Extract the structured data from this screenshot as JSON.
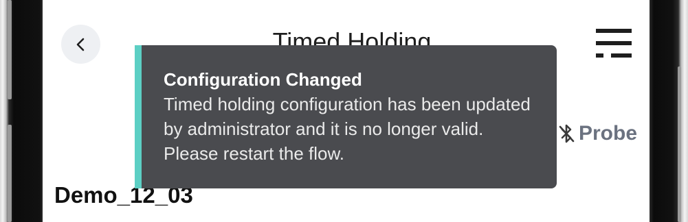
{
  "header": {
    "title": "Timed Holding",
    "back_icon": "chevron-left-icon",
    "menu_icon": "menu-icon"
  },
  "status": {
    "probe_label": "Probe",
    "probe_icon": "bluetooth-off-icon"
  },
  "device": {
    "name": "Demo_12_03"
  },
  "toast": {
    "title": "Configuration Changed",
    "message": "Timed holding configuration has been updated by administrator and it is no longer valid. Please restart the flow.",
    "accent_color": "#5ccfc4",
    "background_color": "#4a4b4f"
  }
}
